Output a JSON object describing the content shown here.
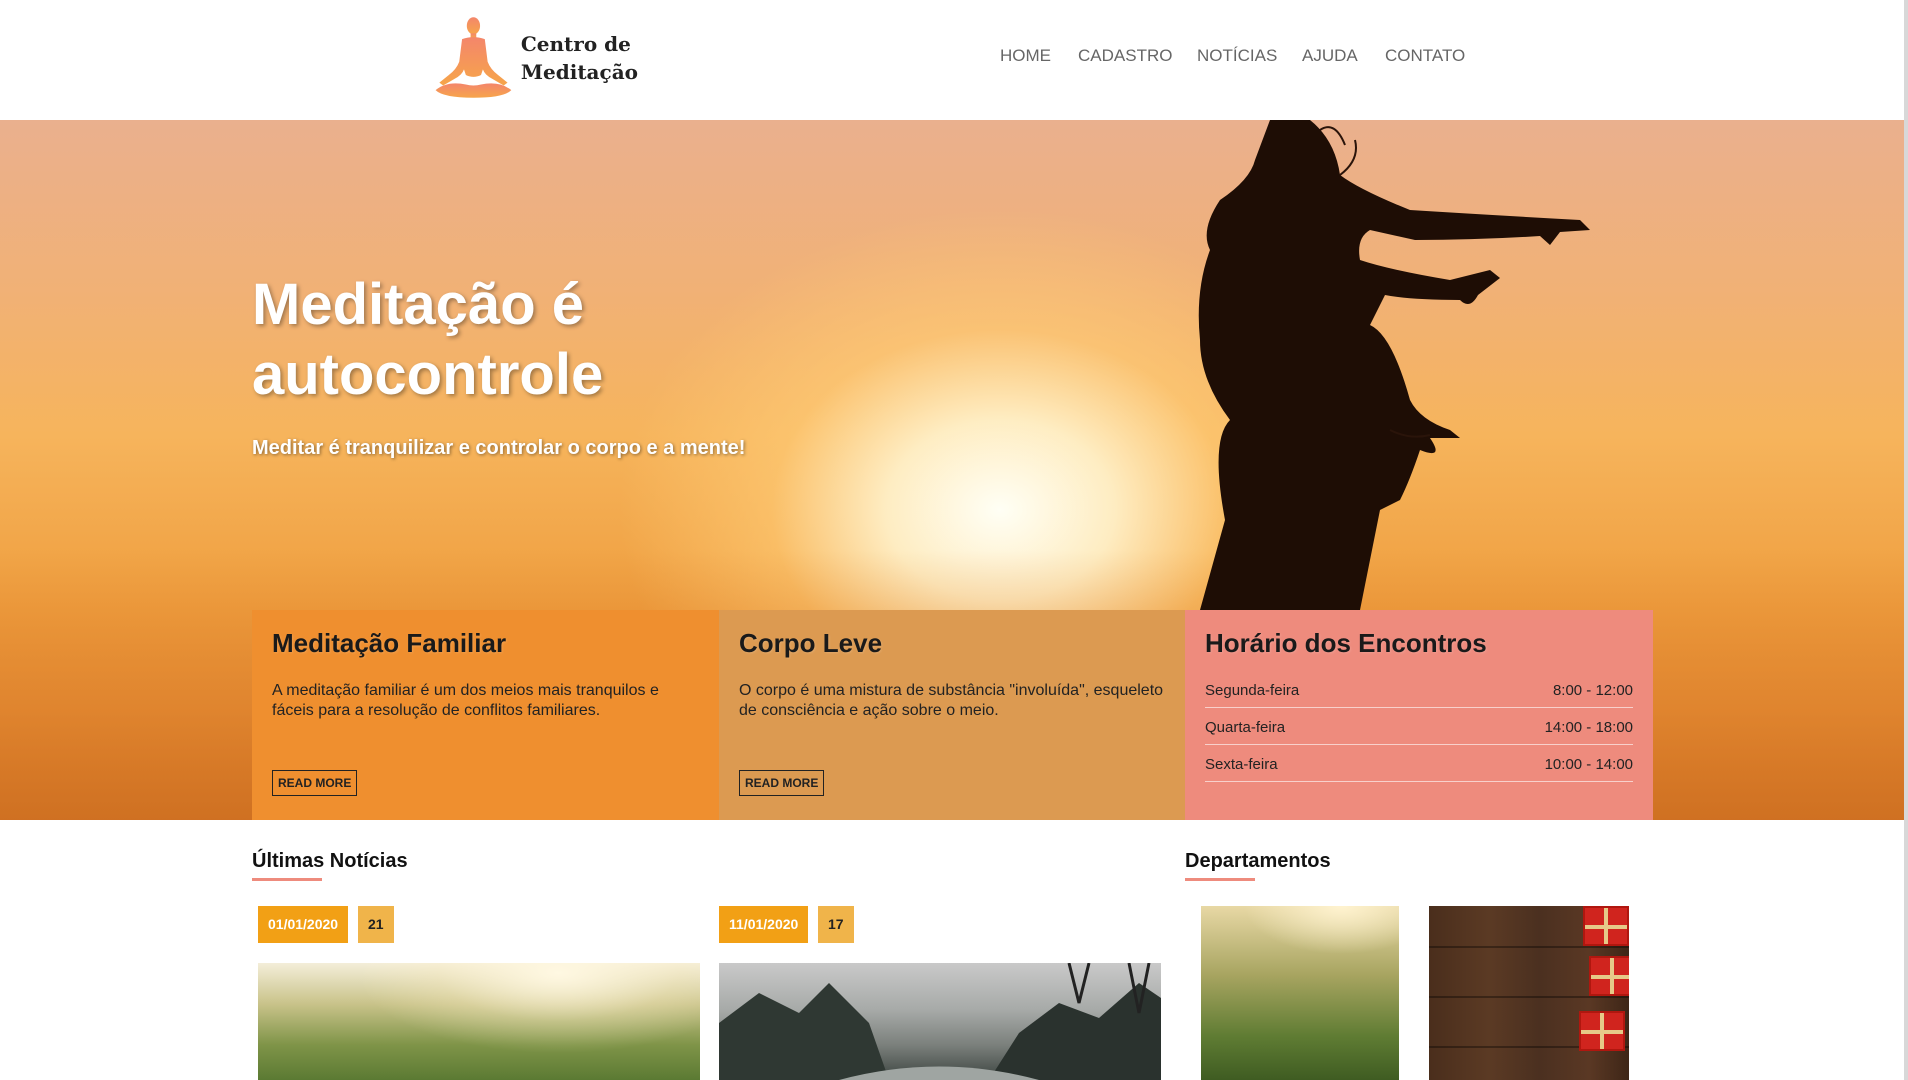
{
  "logo": {
    "line1": "Centro de",
    "line2": "Meditação",
    "icon": "meditation-figure-icon"
  },
  "nav": {
    "items": [
      "HOME",
      "CADASTRO",
      "NOTÍCIAS",
      "AJUDA",
      "CONTATO"
    ]
  },
  "hero": {
    "title_line1": "Meditação é",
    "title_line2": "autocontrole",
    "subtitle": "Meditar é tranquilizar e controlar o corpo e a mente!"
  },
  "features": [
    {
      "title": "Meditação Familiar",
      "text": "A meditação familiar é um dos meios mais tranquilos e fáceis para a resolução de conflitos familiares.",
      "button": "READ MORE"
    },
    {
      "title": "Corpo Leve",
      "text": "O corpo é uma mistura de substância \"involuída\", esqueleto de consciência e ação sobre o meio.",
      "button": "READ MORE"
    }
  ],
  "schedule": {
    "title": "Horário dos Encontros",
    "rows": [
      {
        "day": "Segunda-feira",
        "time": "8:00 - 12:00"
      },
      {
        "day": "Quarta-feira",
        "time": "14:00 - 18:00"
      },
      {
        "day": "Sexta-feira",
        "time": "10:00 - 14:00"
      }
    ]
  },
  "news": {
    "title": "Últimas Notícias",
    "items": [
      {
        "date": "01/01/2020",
        "count": "21"
      },
      {
        "date": "11/01/2020",
        "count": "17"
      }
    ]
  },
  "departments": {
    "title": "Departamentos"
  },
  "colors": {
    "orange": "#ef8f2f",
    "tan": "#dc9a51",
    "salmon": "#ee8b7d",
    "badge": "#f2a015"
  }
}
